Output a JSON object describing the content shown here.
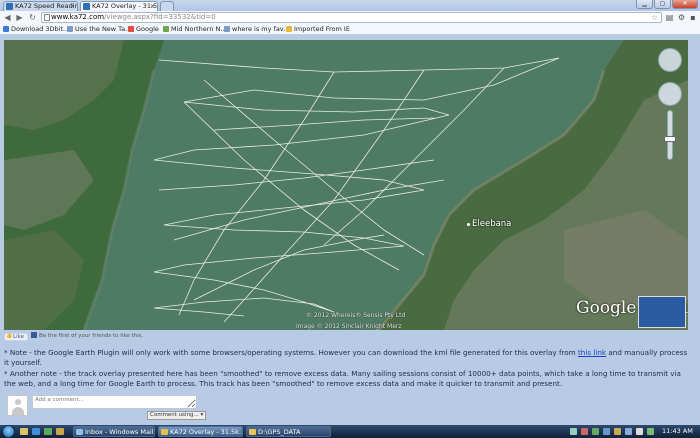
{
  "browser": {
    "tabs": [
      {
        "title": "KA72 Speed Readin",
        "active": false
      },
      {
        "title": "KA72 Overlay - 31.5k",
        "active": true
      }
    ],
    "url_host": "www.ka72.com",
    "url_path": "/viewge.aspx?fid=33532&tid=0",
    "window_controls": [
      "minimize",
      "maximize",
      "close"
    ]
  },
  "bookmarks": [
    {
      "label": "Download 3Dbit...",
      "icon": "download-icon"
    },
    {
      "label": "Use the New Ta...",
      "icon": "page-icon"
    },
    {
      "label": "Google",
      "icon": "google-icon"
    },
    {
      "label": "Mid Northern N...",
      "icon": "page-icon"
    },
    {
      "label": "where is my fav...",
      "icon": "page-icon"
    },
    {
      "label": "Imported From IE",
      "icon": "folder-icon"
    }
  ],
  "map": {
    "place_label": "Eleebana",
    "credit_top": "© 2012 Whereis® Sensis Pty Ltd",
    "credit_bottom": "Image © 2012 Sinclair Knight Merz",
    "logo_text": "Google earth",
    "colors": {
      "water": "#4f7a64",
      "land": "#3e6a3d",
      "track": "#f2f2f2"
    }
  },
  "social": {
    "like_label": "Like",
    "like_text": "Be the first of your friends to like this."
  },
  "notes": {
    "note1_before": "* Note - the Google Earth Plugin will only work with some browsers/operating systems. However you can download the kml file generated for this overlay from ",
    "note1_link": "this link",
    "note1_after": " and manually process it yourself.",
    "note2": "* Another note - the track overlay presented here has been \"smoothed\" to remove excess data. Many sailing sessions consist of 10000+ data points, which take a long time to transmit via the web, and a long time for Google Earth to process. This track has been \"smoothed\" to remove excess data and make it quicker to transmit and present."
  },
  "comments": {
    "placeholder": "Add a comment...",
    "using_label": "Comment using..."
  },
  "taskbar": {
    "tasks": [
      {
        "label": "Inbox - Windows Mail",
        "icon": "mail-icon"
      },
      {
        "label": "KA72 Overlay - 31.5k...",
        "icon": "chrome-icon"
      },
      {
        "label": "D:\\GPS_DATA",
        "icon": "folder-icon"
      }
    ],
    "clock": "11:43 AM"
  }
}
